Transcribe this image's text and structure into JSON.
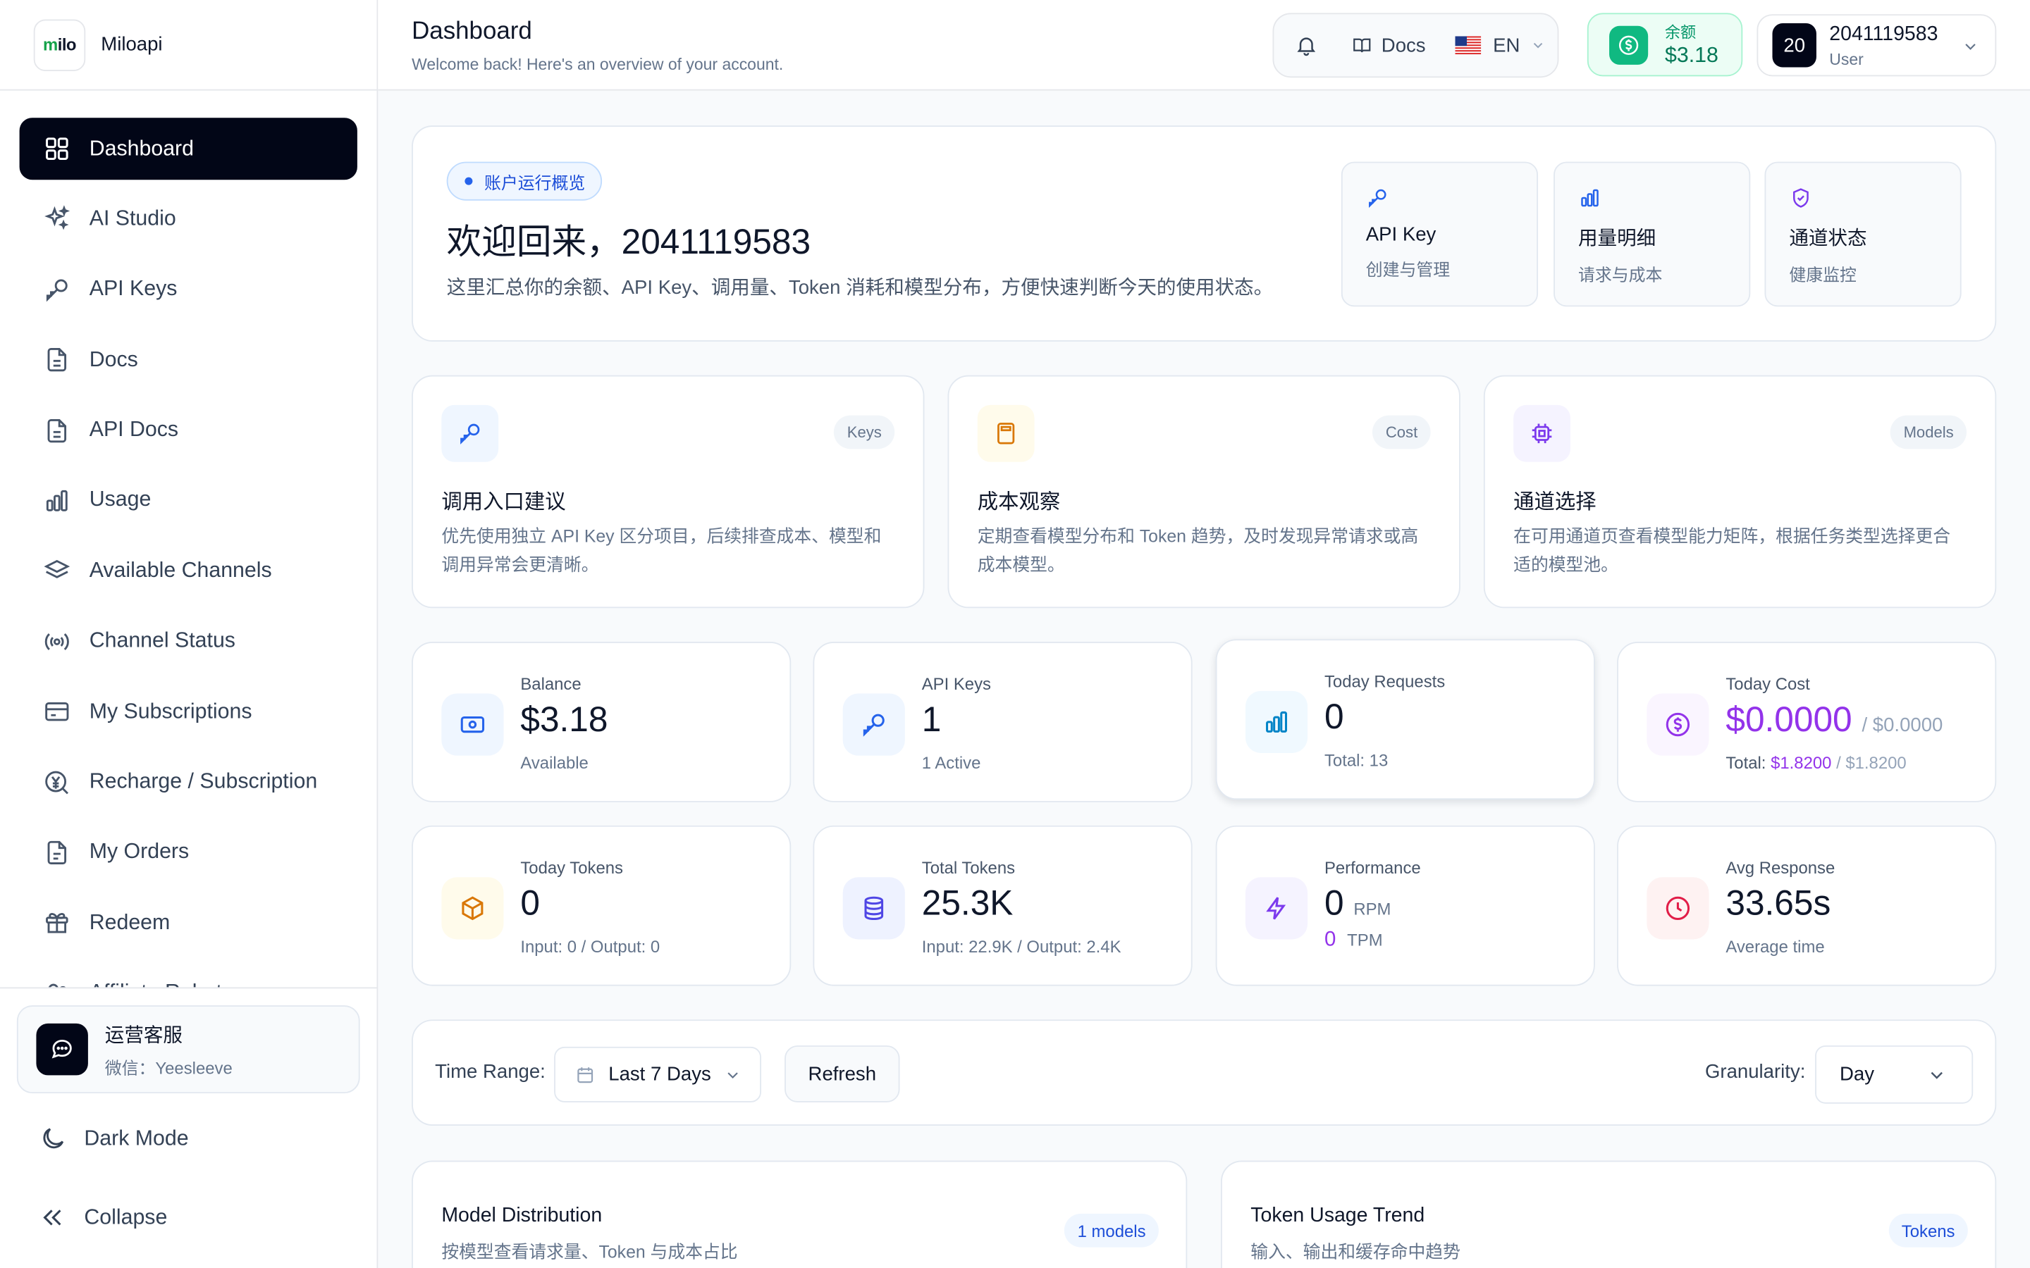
{
  "brand": {
    "logo_text": "milo",
    "name": "Miloapi"
  },
  "sidebar": {
    "items": [
      {
        "label": "Dashboard",
        "icon": "grid-icon",
        "active": true
      },
      {
        "label": "AI Studio",
        "icon": "sparkles-icon"
      },
      {
        "label": "API Keys",
        "icon": "key-icon"
      },
      {
        "label": "Docs",
        "icon": "document-icon"
      },
      {
        "label": "API Docs",
        "icon": "document-icon"
      },
      {
        "label": "Usage",
        "icon": "bar-chart-icon"
      },
      {
        "label": "Available Channels",
        "icon": "layers-icon"
      },
      {
        "label": "Channel Status",
        "icon": "broadcast-icon"
      },
      {
        "label": "My Subscriptions",
        "icon": "credit-card-icon"
      },
      {
        "label": "Recharge / Subscription",
        "icon": "yen-circle-icon"
      },
      {
        "label": "My Orders",
        "icon": "receipt-icon"
      },
      {
        "label": "Redeem",
        "icon": "gift-icon"
      },
      {
        "label": "Affiliate Rebate",
        "icon": "users-icon"
      }
    ],
    "support": {
      "title": "运营客服",
      "subtitle": "微信：Yeesleeve"
    },
    "dark_mode_label": "Dark Mode",
    "collapse_label": "Collapse"
  },
  "header": {
    "title": "Dashboard",
    "subtitle": "Welcome back! Here's an overview of your account.",
    "docs_label": "Docs",
    "lang_label": "EN",
    "balance_label": "余额",
    "balance_value": "$3.18",
    "user_avatar": "20",
    "user_name": "2041119583",
    "user_role": "User"
  },
  "overview": {
    "tag": "账户运行概览",
    "title": "欢迎回来，2041119583",
    "desc": "这里汇总你的余额、API Key、调用量、Token 消耗和模型分布，方便快速判断今天的使用状态。",
    "quick": [
      {
        "title": "API Key",
        "sub": "创建与管理",
        "icon": "key-icon"
      },
      {
        "title": "用量明细",
        "sub": "请求与成本",
        "icon": "bar-chart-icon"
      },
      {
        "title": "通道状态",
        "sub": "健康监控",
        "icon": "shield-check-icon"
      }
    ]
  },
  "tips": [
    {
      "badge": "Keys",
      "title": "调用入口建议",
      "desc": "优先使用独立 API Key 区分项目，后续排查成本、模型和调用异常会更清晰。",
      "icon": "key-icon"
    },
    {
      "badge": "Cost",
      "title": "成本观察",
      "desc": "定期查看模型分布和 Token 趋势，及时发现异常请求或高成本模型。",
      "icon": "calculator-icon"
    },
    {
      "badge": "Models",
      "title": "通道选择",
      "desc": "在可用通道页查看模型能力矩阵，根据任务类型选择更合适的模型池。",
      "icon": "cpu-icon"
    }
  ],
  "stats": {
    "balance": {
      "label": "Balance",
      "value": "$3.18",
      "sub": "Available"
    },
    "api_keys": {
      "label": "API Keys",
      "value": "1",
      "sub": "1 Active"
    },
    "today_requests": {
      "label": "Today Requests",
      "value": "0",
      "sub": "Total: 13"
    },
    "today_cost": {
      "label": "Today Cost",
      "value": "$0.0000",
      "value_ref": "/ $0.0000",
      "sub_prefix": "Total:",
      "sub_value": "$1.8200",
      "sub_ref": "/ $1.8200"
    },
    "today_tokens": {
      "label": "Today Tokens",
      "value": "0",
      "sub": "Input: 0 / Output: 0"
    },
    "total_tokens": {
      "label": "Total Tokens",
      "value": "25.3K",
      "sub": "Input: 22.9K / Output: 2.4K"
    },
    "performance": {
      "label": "Performance",
      "rpm_value": "0",
      "rpm_unit": "RPM",
      "tpm_value": "0",
      "tpm_unit": "TPM"
    },
    "avg_response": {
      "label": "Avg Response",
      "value": "33.65s",
      "sub": "Average time"
    }
  },
  "filters": {
    "time_range_label": "Time Range:",
    "time_range_value": "Last 7 Days",
    "refresh_label": "Refresh",
    "granularity_label": "Granularity:",
    "granularity_value": "Day"
  },
  "panels": {
    "model_distribution": {
      "title": "Model Distribution",
      "sub": "按模型查看请求量、Token 与成本占比",
      "badge": "1 models"
    },
    "token_trend": {
      "title": "Token Usage Trend",
      "sub": "输入、输出和缓存命中趋势",
      "badge": "Tokens"
    }
  },
  "colors": {
    "accent_dark": "#020617",
    "success": "#10b981",
    "primary_blue": "#2563eb",
    "purple": "#9333ea"
  }
}
